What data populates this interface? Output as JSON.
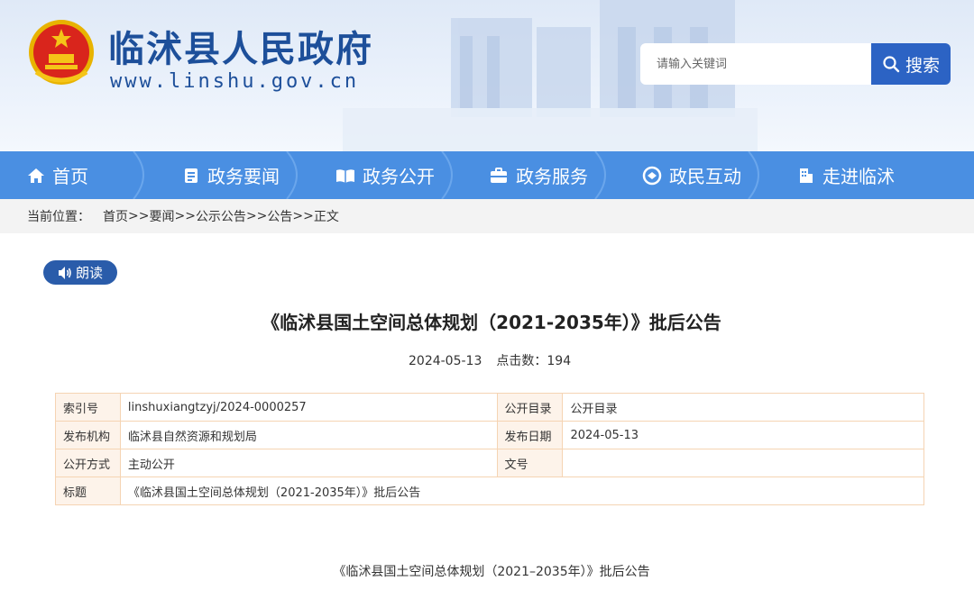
{
  "header": {
    "site_name": "临沭县人民政府",
    "site_url": "www.linshu.gov.cn",
    "search_placeholder": "请输入关键词",
    "search_button": "搜索"
  },
  "nav": {
    "items": [
      {
        "label": "首页",
        "icon": "home-icon"
      },
      {
        "label": "政务要闻",
        "icon": "news-icon"
      },
      {
        "label": "政务公开",
        "icon": "open-book-icon"
      },
      {
        "label": "政务服务",
        "icon": "briefcase-icon"
      },
      {
        "label": "政民互动",
        "icon": "interaction-icon"
      },
      {
        "label": "走进临沭",
        "icon": "building-icon"
      }
    ]
  },
  "breadcrumb": {
    "label": "当前位置：",
    "items": [
      "首页",
      "要闻",
      "公示公告",
      "公告",
      "正文"
    ],
    "separator": ">>"
  },
  "article": {
    "read_button": "朗读",
    "title": "《临沭县国土空间总体规划（2021-2035年）》批后公告",
    "date": "2024-05-13",
    "clicks_label": "点击数：",
    "clicks": "194",
    "body_title": "《临沭县国土空间总体规划（2021–2035年）》批后公告"
  },
  "info_table": {
    "rows": [
      {
        "k1": "索引号",
        "v1": "linshuxiangtzyj/2024-0000257",
        "k2": "公开目录",
        "v2": "公开目录"
      },
      {
        "k1": "发布机构",
        "v1": "临沭县自然资源和规划局",
        "k2": "发布日期",
        "v2": "2024-05-13"
      },
      {
        "k1": "公开方式",
        "v1": "主动公开",
        "k2": "文号",
        "v2": ""
      }
    ],
    "title_row": {
      "k": "标题",
      "v": "《临沭县国土空间总体规划（2021-2035年）》批后公告"
    }
  },
  "colors": {
    "nav_bg": "#4a8fe2",
    "brand_blue": "#1d4f9a",
    "search_button": "#2c63c4",
    "read_button": "#2a5caa",
    "table_border": "#f5d4b3",
    "table_key_bg": "#fdf3ea"
  }
}
